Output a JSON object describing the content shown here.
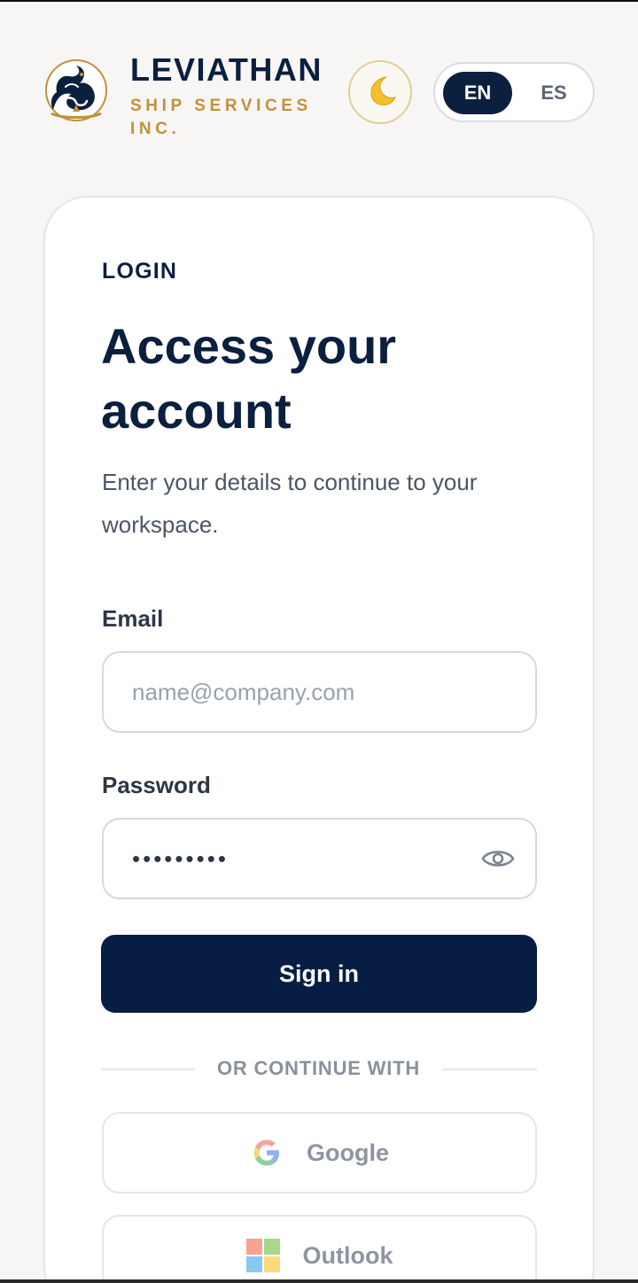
{
  "brand": {
    "name": "LEVIATHAN",
    "subtitle": "SHIP SERVICES INC.",
    "logo_icon": "sea-serpent-logo-icon",
    "gold": "#c1913c",
    "navy": "#0b1f3f"
  },
  "header": {
    "theme_icon": "moon-icon",
    "languages": [
      {
        "code": "EN",
        "active": true
      },
      {
        "code": "ES",
        "active": false
      }
    ]
  },
  "login": {
    "eyebrow": "LOGIN",
    "title": "Access your account",
    "subtitle": "Enter your details to continue to your workspace.",
    "email": {
      "label": "Email",
      "placeholder": "name@company.com",
      "value": ""
    },
    "password": {
      "label": "Password",
      "value": "•••••••••",
      "toggle_icon": "eye-icon"
    },
    "signin_label": "Sign in",
    "divider_text": "OR CONTINUE WITH",
    "providers": [
      {
        "label": "Google",
        "icon": "google-icon"
      },
      {
        "label": "Outlook",
        "icon": "microsoft-icon"
      }
    ],
    "button_color": "#071d43"
  }
}
